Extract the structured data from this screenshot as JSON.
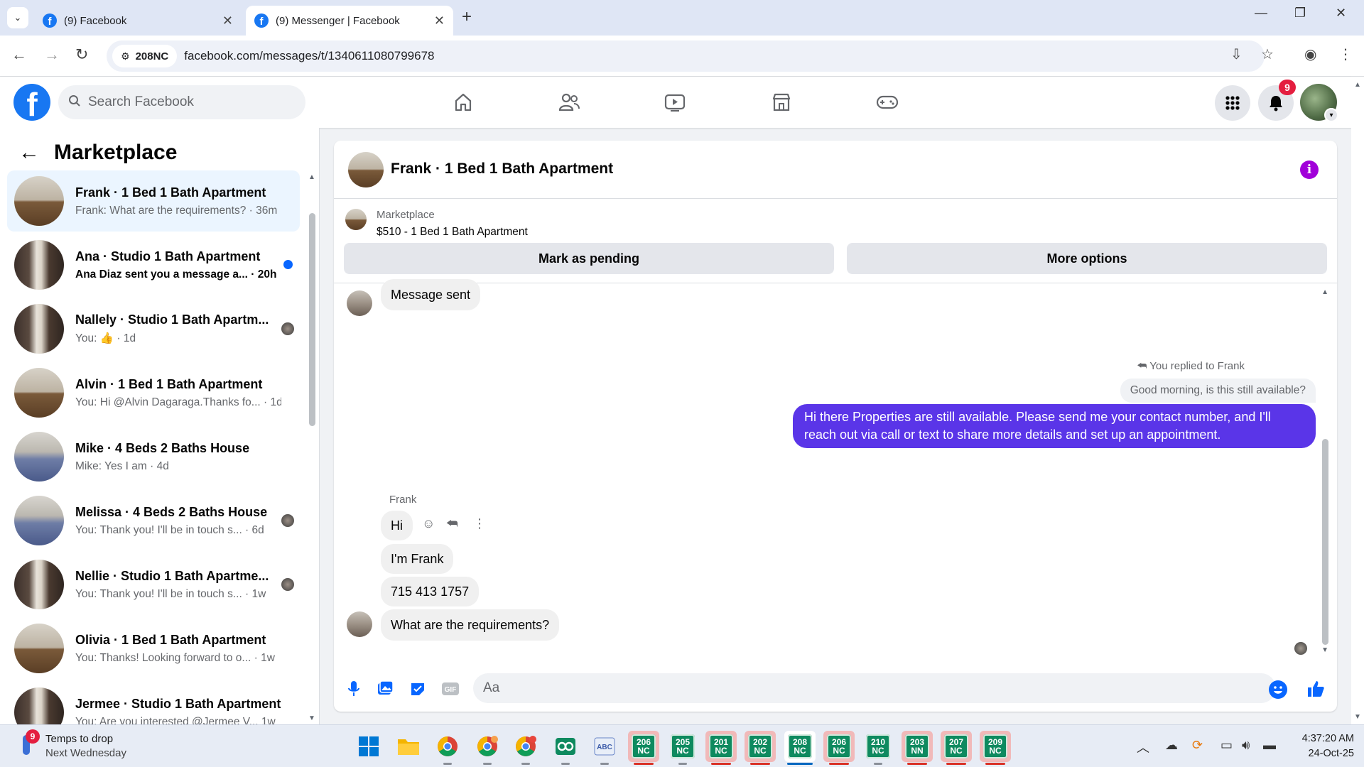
{
  "browser": {
    "tabs": [
      {
        "title": "(9) Facebook",
        "active": false
      },
      {
        "title": "(9) Messenger | Facebook",
        "active": true
      }
    ],
    "site_chip": "208NC",
    "url": "facebook.com/messages/t/1340611080799678"
  },
  "header": {
    "logo": "f",
    "search_placeholder": "Search Facebook",
    "notification_count": "9",
    "nav_icons": [
      "home-icon",
      "friends-icon",
      "video-icon",
      "marketplace-icon",
      "gaming-icon"
    ]
  },
  "sidebar": {
    "title": "Marketplace",
    "conversations": [
      {
        "name": "Frank · 1 Bed 1 Bath Apartment",
        "preview": "Frank: What are the requirements? · 36m",
        "selected": true,
        "unread": false,
        "thumb": "living"
      },
      {
        "name": "Ana · Studio 1 Bath Apartment",
        "preview": "Ana Diaz sent you a message a... · 20h",
        "selected": false,
        "unread": true,
        "thumb": "studio"
      },
      {
        "name": "Nallely · Studio 1 Bath Apartm...",
        "preview": "You: 👍 · 1d",
        "selected": false,
        "unread": false,
        "thumb": "studio",
        "seen": true
      },
      {
        "name": "Alvin · 1 Bed 1 Bath Apartment",
        "preview": "You: Hi @Alvin Dagaraga.Thanks fo... · 1d",
        "selected": false,
        "unread": false,
        "thumb": "living"
      },
      {
        "name": "Mike · 4 Beds 2 Baths House",
        "preview": "Mike: Yes I am · 4d",
        "selected": false,
        "unread": false,
        "thumb": "bed"
      },
      {
        "name": "Melissa · 4 Beds 2 Baths House",
        "preview": "You: Thank you! I'll be in touch s... · 6d",
        "selected": false,
        "unread": false,
        "thumb": "bed",
        "seen": true
      },
      {
        "name": "Nellie · Studio 1 Bath Apartme...",
        "preview": "You: Thank you! I'll be in touch s... · 1w",
        "selected": false,
        "unread": false,
        "thumb": "studio",
        "seen": true
      },
      {
        "name": "Olivia · 1 Bed 1 Bath Apartment",
        "preview": "You: Thanks! Looking forward to o... · 1w",
        "selected": false,
        "unread": false,
        "thumb": "living"
      },
      {
        "name": "Jermee · Studio 1 Bath Apartment",
        "preview": "You: Are you interested @Jermee V... 1w",
        "selected": false,
        "unread": false,
        "thumb": "studio"
      }
    ]
  },
  "chat": {
    "title": "Frank · 1 Bed 1 Bath Apartment",
    "listing_label": "Marketplace",
    "listing_detail": "$510 - 1 Bed 1 Bath Apartment",
    "mark_pending_label": "Mark as pending",
    "more_options_label": "More options",
    "messages": {
      "system": "Message sent",
      "replied_label": "You replied to Frank",
      "quoted": "Good morning, is this still available?",
      "outgoing": "Hi there Properties are still available. Please send me your contact number, and I'll reach out via call or text to share more details and set up an appointment.",
      "sender_name": "Frank",
      "incoming": [
        "Hi",
        "I'm Frank",
        "715 413 1757",
        "What are the requirements?"
      ]
    },
    "composer_placeholder": "Aa"
  },
  "taskbar": {
    "weather_badge": "9",
    "weather_line1": "Temps to drop",
    "weather_line2": "Next Wednesday",
    "nc_apps": [
      {
        "top": "206",
        "bottom": "NC",
        "boxed": true
      },
      {
        "top": "205",
        "bottom": "NC",
        "boxed": false
      },
      {
        "top": "201",
        "bottom": "NC",
        "boxed": true
      },
      {
        "top": "202",
        "bottom": "NC",
        "boxed": true
      },
      {
        "top": "208",
        "bottom": "NC",
        "boxed": false,
        "selected": true
      },
      {
        "top": "206",
        "bottom": "NC",
        "boxed": true
      },
      {
        "top": "210",
        "bottom": "NC",
        "boxed": false
      },
      {
        "top": "203",
        "bottom": "NN",
        "boxed": true
      },
      {
        "top": "207",
        "bottom": "NC",
        "boxed": true
      },
      {
        "top": "209",
        "bottom": "NC",
        "boxed": true
      }
    ],
    "time": "4:37:20 AM",
    "date": "24-Oct-25"
  },
  "colors": {
    "fb_blue": "#1877f2",
    "outgoing_bubble": "#5a35e8",
    "selected_row": "#ebf5ff",
    "badge_red": "#e41e3f",
    "info_purple": "#a100d9"
  }
}
